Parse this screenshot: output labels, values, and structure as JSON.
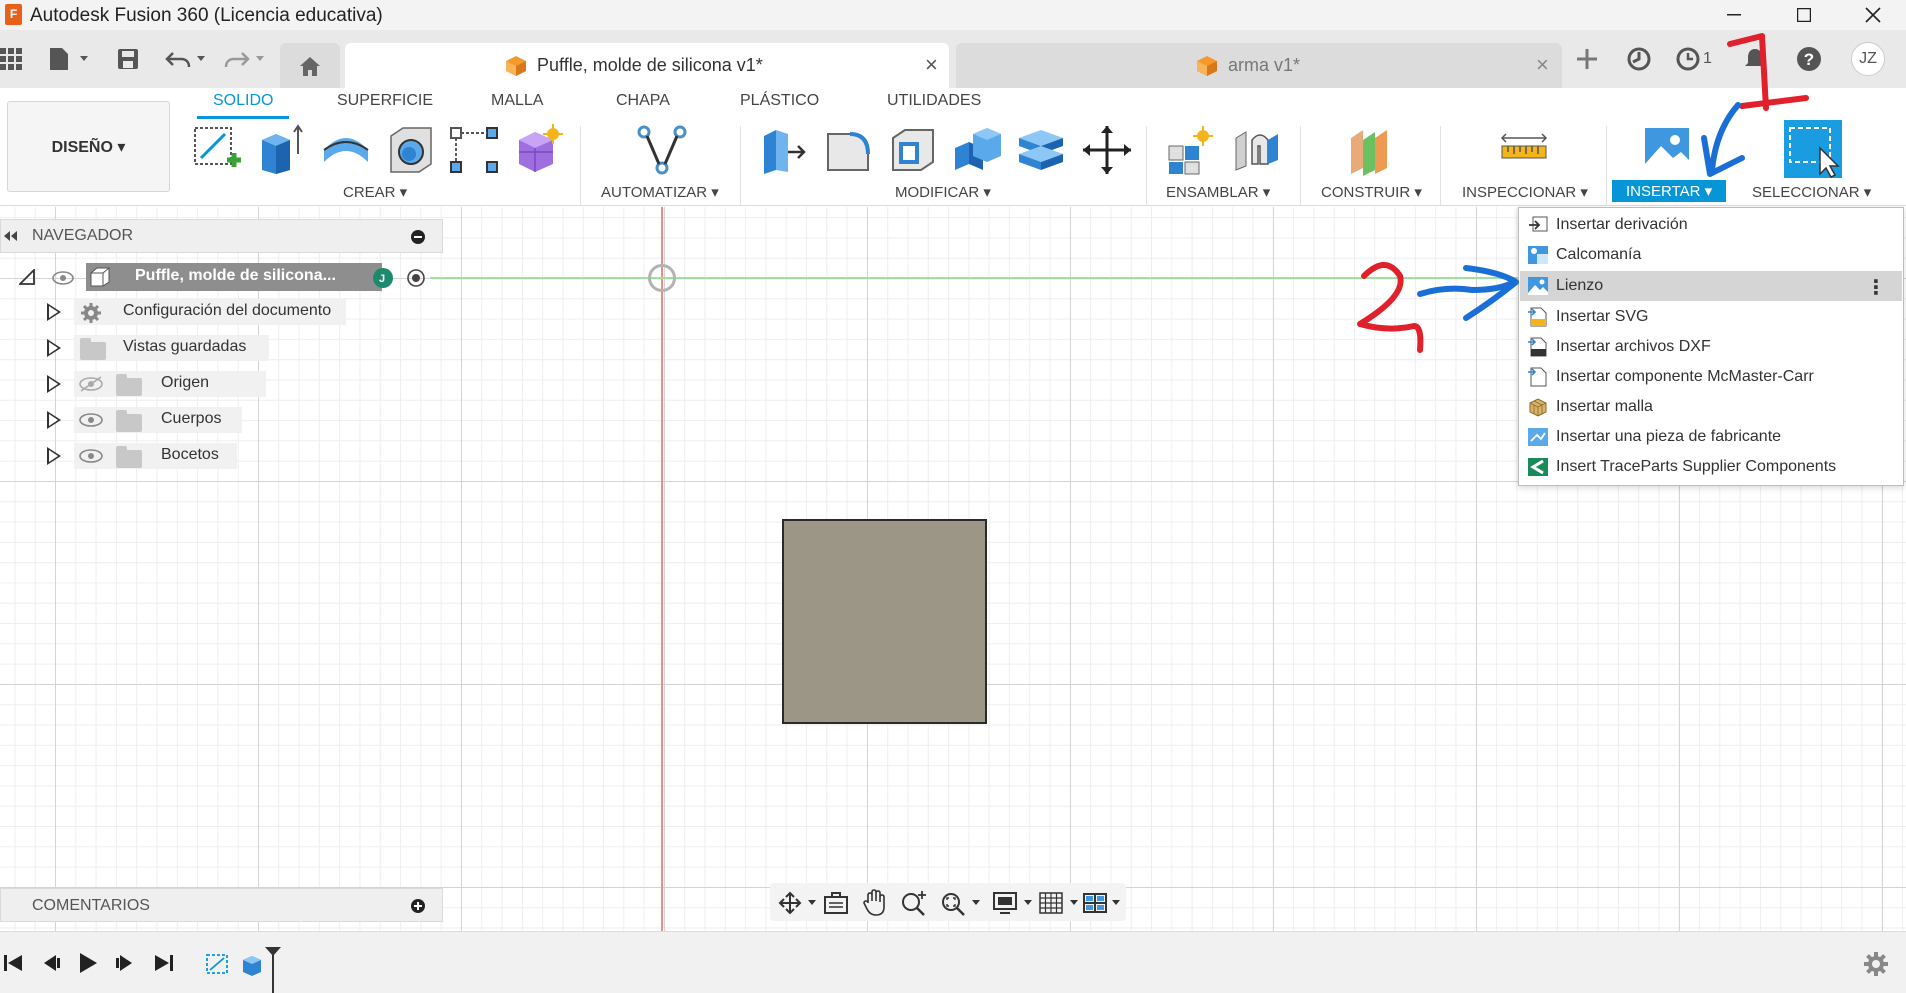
{
  "window": {
    "title": "Autodesk Fusion 360 (Licencia educativa)",
    "logo_letter": "F",
    "controls": [
      "minimize-icon",
      "maximize-icon",
      "close-icon"
    ]
  },
  "tabs": [
    {
      "label": "Puffle, molde de silicona v1*",
      "active": true
    },
    {
      "label": "arma v1*",
      "active": false
    }
  ],
  "tabbar_right": {
    "job_count": "1",
    "user_initials": "JZ"
  },
  "toolbar": {
    "workspace": "DISEÑO ▾",
    "workspace_tabs": [
      "SOLIDO",
      "SUPERFICIE",
      "MALLA",
      "CHAPA",
      "PLÁSTICO",
      "UTILIDADES"
    ],
    "groups": [
      "CREAR ▾",
      "AUTOMATIZAR ▾",
      "MODIFICAR ▾",
      "ENSAMBLAR ▾",
      "CONSTRUIR ▾",
      "INSPECCIONAR ▾",
      "INSERTAR ▾",
      "SELECCIONAR ▾"
    ]
  },
  "navigator": {
    "title": "NAVEGADOR",
    "root": "Puffle, molde de silicona...",
    "items": [
      {
        "label": "Configuración del documento"
      },
      {
        "label": "Vistas guardadas"
      },
      {
        "label": "Origen"
      },
      {
        "label": "Cuerpos"
      },
      {
        "label": "Bocetos"
      }
    ]
  },
  "comments": {
    "title": "COMENTARIOS"
  },
  "insert_menu": {
    "items": [
      {
        "label": "Insertar derivación"
      },
      {
        "label": "Calcomanía"
      },
      {
        "label": "Lienzo",
        "selected": true
      },
      {
        "label": "Insertar SVG"
      },
      {
        "label": "Insertar archivos DXF"
      },
      {
        "label": "Insertar componente McMaster-Carr"
      },
      {
        "label": "Insertar malla"
      },
      {
        "label": "Insertar una pieza de fabricante"
      },
      {
        "label": "Insert TraceParts Supplier Components"
      }
    ]
  },
  "annotations": {
    "step1": "1",
    "step2": "2"
  },
  "colors": {
    "accent": "#0696d7",
    "annotation_red": "#e0202a",
    "annotation_blue": "#1a6fd6",
    "body": "#9b9686"
  }
}
